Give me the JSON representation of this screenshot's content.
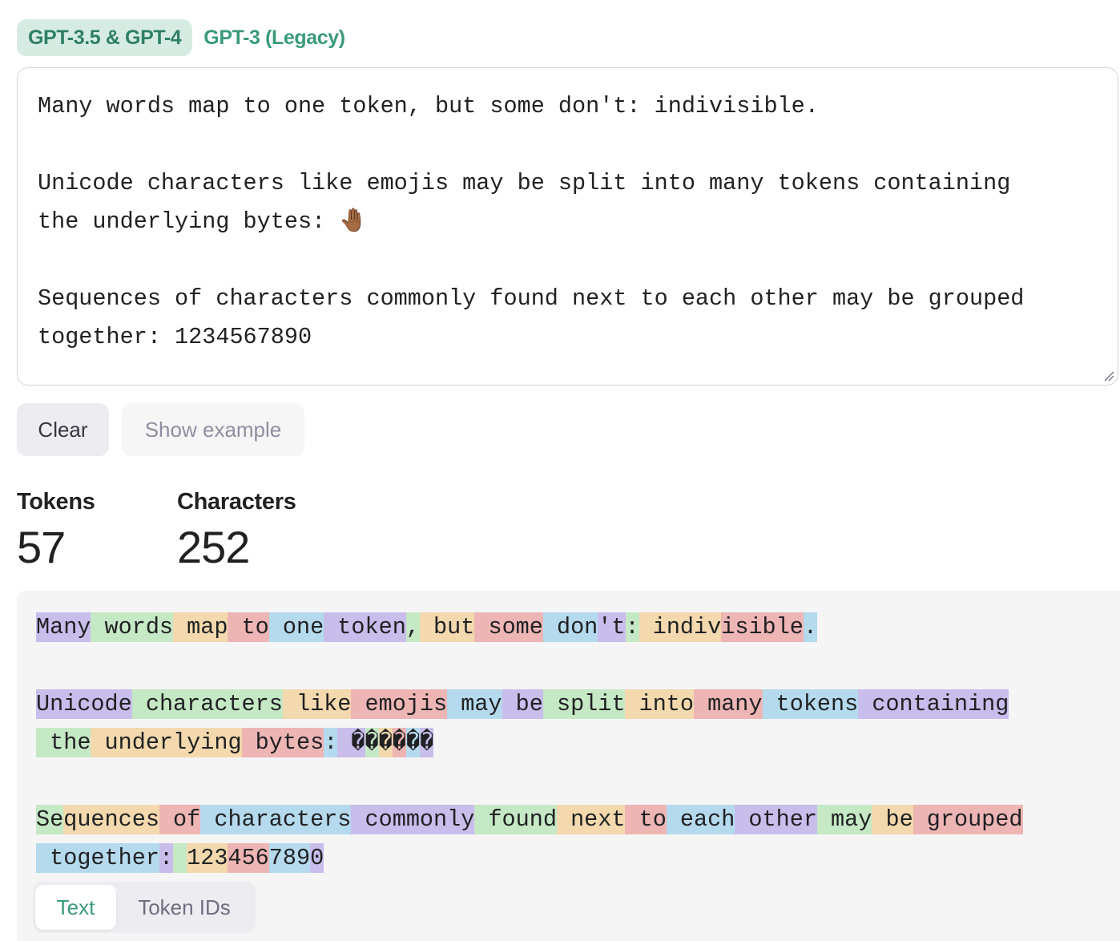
{
  "model_tabs": [
    {
      "label": "GPT-3.5 & GPT-4",
      "active": true
    },
    {
      "label": "GPT-3 (Legacy)",
      "active": false
    }
  ],
  "input": {
    "value": "Many words map to one token, but some don't: indivisible.\n\nUnicode characters like emojis may be split into many tokens containing\nthe underlying bytes: 🤚🏾\n\nSequences of characters commonly found next to each other may be grouped\ntogether: 1234567890"
  },
  "buttons": {
    "clear": "Clear",
    "show_example": "Show example"
  },
  "stats": {
    "tokens_label": "Tokens",
    "tokens_value": "57",
    "characters_label": "Characters",
    "characters_value": "252"
  },
  "tokens": [
    [
      "Many",
      " words",
      " map",
      " to",
      " one",
      " token",
      ",",
      " but",
      " some",
      " don",
      "'t",
      ":",
      " indiv",
      "isible",
      "."
    ],
    [],
    [
      "Unicode",
      " characters",
      " like",
      " emojis",
      " may",
      " be",
      " split",
      " into",
      " many",
      " tokens",
      " containing"
    ],
    [
      " the",
      " underlying",
      " bytes",
      ":",
      " �",
      "�",
      "�",
      "�",
      "�",
      "�"
    ],
    [],
    [
      "Se",
      "quences",
      " of",
      " characters",
      " commonly",
      " found",
      " next",
      " to",
      " each",
      " other",
      " may",
      " be",
      " grouped"
    ],
    [
      " together",
      ":",
      " ",
      "123",
      "456",
      "789",
      "0"
    ]
  ],
  "colors": {
    "purple": "#c9bdec",
    "green": "#c5e8c5",
    "orange": "#f3d9ad",
    "red": "#eeb5b5",
    "blue": "#b5daee",
    "accent": "#3a9a7a"
  },
  "view_toggle": {
    "text": "Text",
    "token_ids": "Token IDs",
    "active": "Text"
  }
}
